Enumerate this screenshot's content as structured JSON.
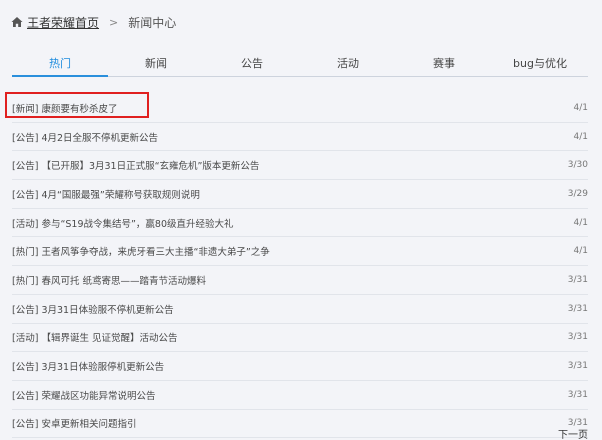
{
  "breadcrumb": {
    "home_label": "王者荣耀首页",
    "separator": ">",
    "current": "新闻中心",
    "home_icon": "home-icon"
  },
  "tabs": [
    {
      "label": "热门",
      "active": true
    },
    {
      "label": "新闻",
      "active": false
    },
    {
      "label": "公告",
      "active": false
    },
    {
      "label": "活动",
      "active": false
    },
    {
      "label": "赛事",
      "active": false
    },
    {
      "label": "bug与优化",
      "active": false
    }
  ],
  "news": [
    {
      "tag": "[新闻]",
      "title": "康颜要有秒杀皮了",
      "date": "4/1"
    },
    {
      "tag": "[公告]",
      "title": "4月2日全服不停机更新公告",
      "date": "4/1"
    },
    {
      "tag": "[公告]",
      "title": "【已开服】3月31日正式服“玄雍危机”版本更新公告",
      "date": "3/30"
    },
    {
      "tag": "[公告]",
      "title": "4月“国服最强”荣耀称号获取规则说明",
      "date": "3/29"
    },
    {
      "tag": "[活动]",
      "title": "参与“S19战令集结号”，赢80级直升经验大礼",
      "date": "4/1"
    },
    {
      "tag": "[热门]",
      "title": "王者风筝争夺战，来虎牙看三大主播“非遗大弟子”之争",
      "date": "4/1"
    },
    {
      "tag": "[热门]",
      "title": "春风可托 纸鸢寄思——踏青节活动爆料",
      "date": "3/31"
    },
    {
      "tag": "[公告]",
      "title": "3月31日体验服不停机更新公告",
      "date": "3/31"
    },
    {
      "tag": "[活动]",
      "title": "【辑界诞生 见证觉醒】活动公告",
      "date": "3/31"
    },
    {
      "tag": "[公告]",
      "title": "3月31日体验服停机更新公告",
      "date": "3/31"
    },
    {
      "tag": "[公告]",
      "title": "荣耀战区功能异常说明公告",
      "date": "3/31"
    },
    {
      "tag": "[公告]",
      "title": "安卓更新相关问题指引",
      "date": "3/31"
    }
  ],
  "pagination": {
    "next_label": "下一页"
  },
  "colors": {
    "active_tab": "#1e8cde",
    "highlight": "#e02020"
  }
}
